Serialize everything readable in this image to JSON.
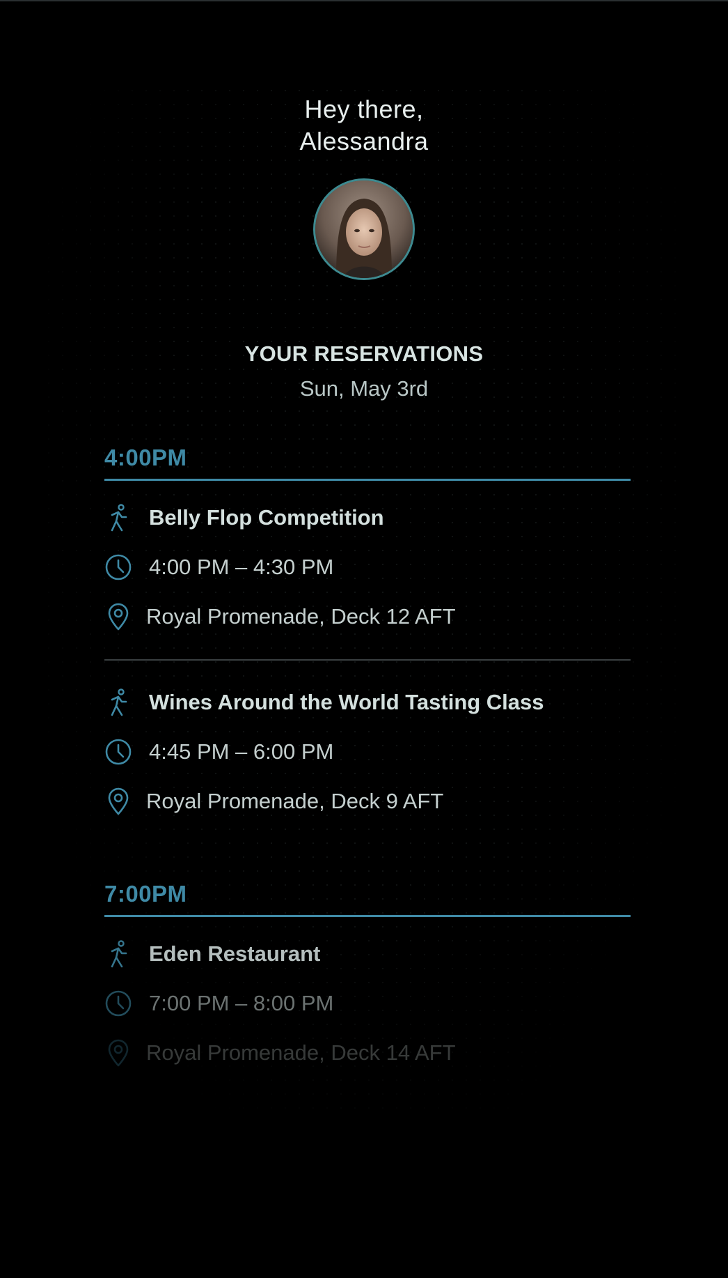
{
  "greeting": {
    "line1": "Hey there,",
    "line2": "Alessandra"
  },
  "avatar": {
    "icon": "profile-photo"
  },
  "reservations": {
    "title": "YOUR RESERVATIONS",
    "date": "Sun, May 3rd"
  },
  "groups": [
    {
      "time": "4:00PM",
      "events": [
        {
          "title": "Belly Flop Competition",
          "time_range": "4:00 PM – 4:30 PM",
          "location": "Royal Promenade, Deck 12 AFT"
        },
        {
          "title": "Wines Around the World Tasting Class",
          "time_range": "4:45 PM – 6:00 PM",
          "location": "Royal Promenade, Deck 9 AFT"
        }
      ]
    },
    {
      "time": "7:00PM",
      "events": [
        {
          "title": "Eden Restaurant",
          "time_range": "7:00 PM – 8:00 PM",
          "location": "Royal Promenade, Deck 14 AFT"
        }
      ]
    }
  ],
  "colors": {
    "accent": "#3f8aa6",
    "avatar_ring": "#3d8a90",
    "background": "#000000",
    "separator": "#3a3f41"
  },
  "icons": {
    "activity": "walking-person-icon",
    "time": "clock-icon",
    "location": "map-pin-icon"
  }
}
